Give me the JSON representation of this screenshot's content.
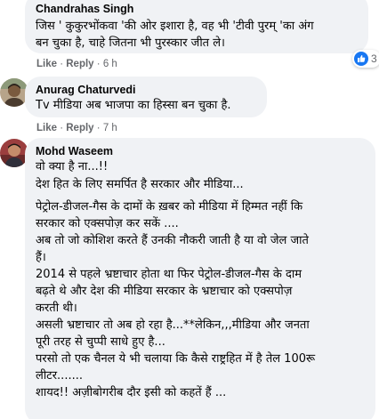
{
  "comments": [
    {
      "author": "Chandrahas Singh",
      "lines": [
        "जिस ' कुकुरभोंकवा 'की ओर इशारा है, वह भी 'टीवी पुरम् 'का अंग",
        "बन चुका है, चाहे जितना भी पुरस्कार जीत ले।"
      ],
      "like_label": "Like",
      "reply_label": "Reply",
      "time": "6 h",
      "reaction_count": "3"
    },
    {
      "author": "Anurag Chaturvedi",
      "lines": [
        "Tv मीडिया अब भाजपा का हिस्सा बन चुका है."
      ],
      "like_label": "Like",
      "reply_label": "Reply",
      "time": "7 h"
    },
    {
      "author": "Mohd Waseem",
      "lines": [
        "वो क्या है ना...!!",
        "देश हित के लिए समर्पित है सरकार और मीडिया...",
        "पेट्रोल-डीजल-गैस के दामों के ख़बर को मीडिया में हिम्मत नहीं कि",
        "सरकार को एक्सपोज़ कर सकें ....",
        "अब तो जो कोशिश करते हैं उनकी नौकरी जाती है या वो जेल जाते",
        "हैं।",
        "2014 से पहले भ्रष्टाचार होता था फिर पेट्रोल-डीजल-गैस के दाम",
        "बढ़ते थे और देश की मीडिया सरकार के भ्रष्टाचार को एक्सपोज़",
        "करती थी।",
        "असली भ्रष्टाचार तो अब हो रहा है...**लेकिन,,,मीडिया और जनता",
        "पूरी तरह से चुप्पी साधे हुए है...",
        "परसो तो एक चैनल ये भी चलाया कि कैसे राष्ट्रहित में है तेल 100रू",
        "लीटर.......",
        "शायद!! अज़ीबोगरीब दौर इसी को कहतें हैं ..."
      ]
    }
  ],
  "separator": "·",
  "colors": {
    "bubble": "#f0f2f5",
    "meta_text": "#65676b",
    "like_blue": "#1877f2"
  },
  "icons": {
    "reaction": "thumbs-up-icon"
  }
}
